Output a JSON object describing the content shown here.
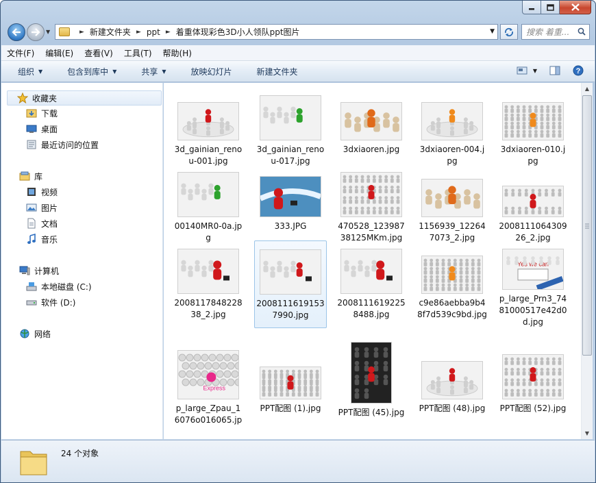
{
  "address": {
    "breadcrumb": [
      "新建文件夹",
      "ppt",
      "着重体现彩色3D小人领队ppt图片"
    ]
  },
  "search": {
    "placeholder": "搜索 着重..."
  },
  "menu": [
    "文件(F)",
    "编辑(E)",
    "查看(V)",
    "工具(T)",
    "帮助(H)"
  ],
  "commands": {
    "organize": "组织",
    "include": "包含到库中",
    "share": "共享",
    "slideshow": "放映幻灯片",
    "new_folder": "新建文件夹"
  },
  "nav": {
    "favorites": "收藏夹",
    "fav_items": [
      "下载",
      "桌面",
      "最近访问的位置"
    ],
    "libraries": "库",
    "lib_items": [
      "视频",
      "图片",
      "文档",
      "音乐"
    ],
    "computer": "计算机",
    "drives": [
      "本地磁盘 (C:)",
      "软件 (D:)"
    ],
    "network": "网络"
  },
  "files": [
    {
      "name": "3d_gainian_renou-001.jpg",
      "kind": "ring-red"
    },
    {
      "name": "3d_gainian_renou-017.jpg",
      "kind": "runners-green"
    },
    {
      "name": "3dxiaoren.jpg",
      "kind": "group-orange"
    },
    {
      "name": "3dxiaoren-004.jpg",
      "kind": "ring-orange"
    },
    {
      "name": "3dxiaoren-010.jpg",
      "kind": "crowd-orange"
    },
    {
      "name": "00140MR0-0a.jpg",
      "kind": "runners-green"
    },
    {
      "name": "333.JPG",
      "kind": "track-red"
    },
    {
      "name": "470528_12398738125MKm.jpg",
      "kind": "rows-red"
    },
    {
      "name": "1156939_122647073_2.jpg",
      "kind": "group-orange"
    },
    {
      "name": "200811106430926_2.jpg",
      "kind": "line-red"
    },
    {
      "name": "200811784822838_2.jpg",
      "kind": "runner-red"
    },
    {
      "name": "2008111619153 7990.jpg",
      "kind": "runners-red"
    },
    {
      "name": "20081116192258488.jpg",
      "kind": "runner-red"
    },
    {
      "name": "c9e86aebba9b48f7d539c9bd.jpg",
      "kind": "crowd-orange"
    },
    {
      "name": "p_large_Prn3_7481000517e42d0d.jpg",
      "kind": "election"
    },
    {
      "name": "p_large_Zpau_16076o016065.jp",
      "kind": "balls-pink"
    },
    {
      "name": "PPT配图 (1).jpg",
      "kind": "rows-small"
    },
    {
      "name": "PPT配图 (45).jpg",
      "kind": "dark-red"
    },
    {
      "name": "PPT配图 (48).jpg",
      "kind": "ring-red"
    },
    {
      "name": "PPT配图 (52).jpg",
      "kind": "grid-red"
    }
  ],
  "selected_index": 11,
  "status": {
    "count": "24 个对象"
  }
}
